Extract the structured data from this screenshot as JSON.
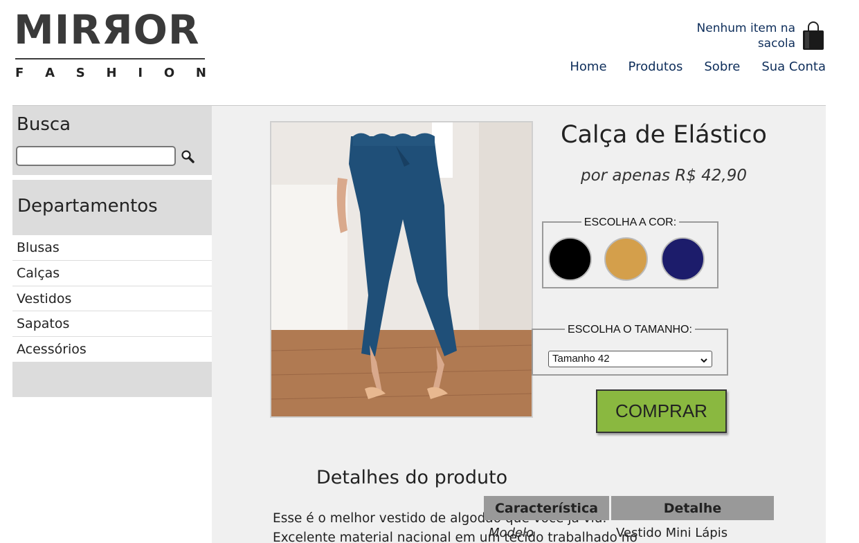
{
  "brand": {
    "name": "MIRЯOR",
    "sub_letters": [
      "F",
      "A",
      "S",
      "H",
      "I",
      "O",
      "N"
    ]
  },
  "cart": {
    "text": "Nenhum item na sacola",
    "icon": "shopping-bag-icon"
  },
  "nav": {
    "items": [
      {
        "label": "Home"
      },
      {
        "label": "Produtos"
      },
      {
        "label": "Sobre"
      },
      {
        "label": "Sua Conta"
      }
    ]
  },
  "sidebar": {
    "search_title": "Busca",
    "search_value": "",
    "search_icon": "magnifier-icon",
    "departments_title": "Departamentos",
    "departments": [
      "Blusas",
      "Calças",
      "Vestidos",
      "Sapatos",
      "Acessórios"
    ]
  },
  "product": {
    "title": "Calça de Elástico",
    "price": "por apenas R$ 42,90",
    "color_legend": "ESCOLHA A COR:",
    "colors": [
      "#000000",
      "#d49f4b",
      "#1c1c6b"
    ],
    "size_legend": "ESCOLHA O TAMANHO:",
    "size_selected": "Tamanho 42",
    "buy_label": "COMPRAR"
  },
  "details": {
    "title": "Detalhes do produto",
    "text": "Esse é o melhor vestido de algodão que você já viu. Excelente material nacional em um tecido trabalhado no",
    "table": {
      "headers": [
        "Característica",
        "Detalhe"
      ],
      "rows": [
        [
          "Modelo",
          "Vestido Mini Lápis"
        ]
      ]
    }
  },
  "colors": {
    "nav_text": "#0d2d5a",
    "buy_green": "#8ab840",
    "panel": "#f0f0f0",
    "sidebar": "#dcdcdc"
  }
}
